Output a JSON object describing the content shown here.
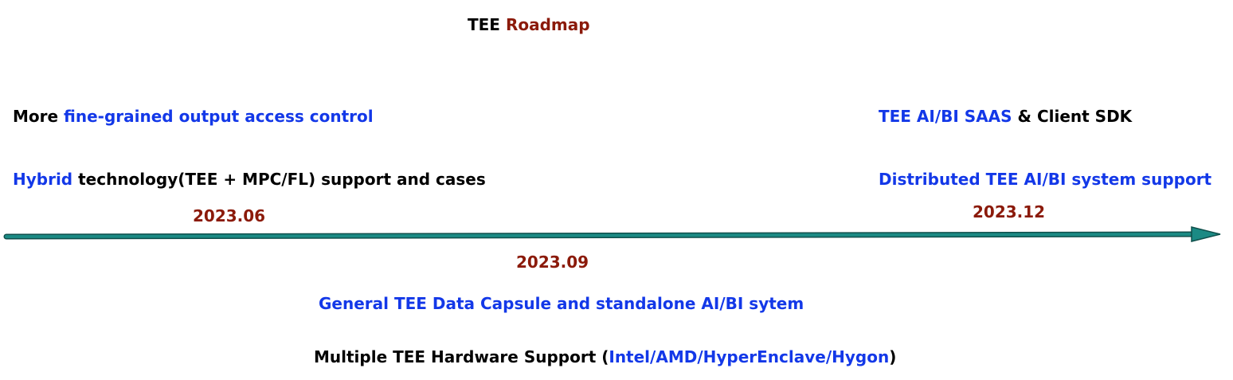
{
  "title": {
    "part1": "TEE",
    "part2": "Roadmap"
  },
  "milestones": {
    "m1": {
      "date": "2023.06",
      "line1": {
        "a": "More ",
        "b": "fine-grained output access control"
      },
      "line2": {
        "a": "Hybrid",
        "b": " technology(TEE + MPC/FL) support and cases"
      }
    },
    "m2": {
      "date": "2023.09",
      "line1": {
        "a": "General TEE Data Capsule and standalone AI/BI sytem"
      },
      "line2": {
        "a": "Multiple TEE Hardware Support (",
        "b": "Intel/AMD/HyperEnclave/Hygon",
        "c": ")"
      }
    },
    "m3": {
      "date": "2023.12",
      "line1": {
        "a": "TEE AI/BI SAAS",
        "b": " & Client SDK"
      },
      "line2": {
        "a": "Distributed TEE AI/BI system support"
      }
    }
  },
  "colors": {
    "blue": "#1338e8",
    "red": "#8b1a0a",
    "timeline": "#1b8a84"
  }
}
